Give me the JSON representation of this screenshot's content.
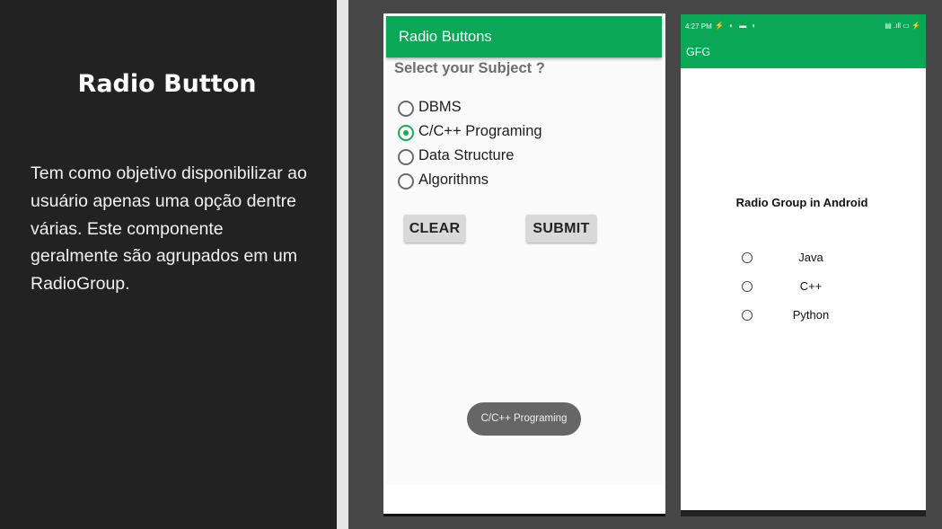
{
  "slide": {
    "title": "Radio Button",
    "body": "Tem como objetivo disponibilizar ao usuário apenas uma opção dentre várias. Este componente geralmente são agrupados em um RadioGroup."
  },
  "phone1": {
    "appbar_title": "Radio Buttons",
    "question": "Select your Subject ?",
    "options": [
      {
        "label": "DBMS",
        "checked": false
      },
      {
        "label": "C/C++ Programing",
        "checked": true
      },
      {
        "label": "Data Structure",
        "checked": false
      },
      {
        "label": "Algorithms",
        "checked": false
      }
    ],
    "clear_label": "CLEAR",
    "submit_label": "SUBMIT",
    "toast": "C/C++ Programing",
    "accent": "#0aa856"
  },
  "phone2": {
    "status_time": "4:27 PM",
    "appbar_title": "GFG",
    "heading": "Radio Group in Android",
    "options": [
      "Java",
      "C++",
      "Python"
    ],
    "accent": "#0aa856"
  }
}
